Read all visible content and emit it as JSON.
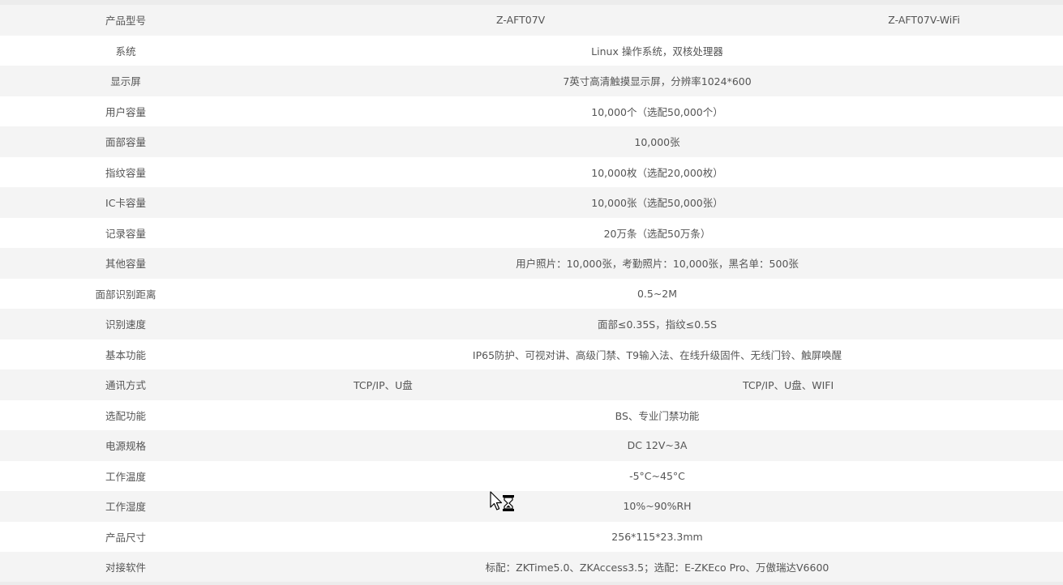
{
  "spec_table": {
    "rows": [
      {
        "label": "产品型号",
        "split": true,
        "left": "Z-AFT07V",
        "right": "Z-AFT07V-WiFi",
        "style": "model"
      },
      {
        "label": "系统",
        "value": "Linux 操作系统，双核处理器"
      },
      {
        "label": "显示屏",
        "value": "7英寸高清触摸显示屏，分辨率1024*600"
      },
      {
        "label": "用户容量",
        "value": "10,000个（选配50,000个）"
      },
      {
        "label": "面部容量",
        "value": "10,000张"
      },
      {
        "label": "指纹容量",
        "value": "10,000枚（选配20,000枚）"
      },
      {
        "label": "IC卡容量",
        "value": "10,000张（选配50,000张）"
      },
      {
        "label": "记录容量",
        "value": "20万条（选配50万条）"
      },
      {
        "label": "其他容量",
        "value": "用户照片：10,000张，考勤照片：10,000张，黑名单：500张"
      },
      {
        "label": "面部识别距离",
        "value": "0.5~2M"
      },
      {
        "label": "识别速度",
        "value": "面部≤0.35S，指纹≤0.5S"
      },
      {
        "label": "基本功能",
        "value": "IP65防护、可视对讲、高级门禁、T9输入法、在线升级固件、无线门铃、触屏唤醒"
      },
      {
        "label": "通讯方式",
        "split": true,
        "left": "TCP/IP、U盘",
        "right": "TCP/IP、U盘、WIFI",
        "style": "comm"
      },
      {
        "label": "选配功能",
        "value": "BS、专业门禁功能"
      },
      {
        "label": "电源规格",
        "value": "DC 12V~3A"
      },
      {
        "label": "工作温度",
        "value": "-5°C~45°C"
      },
      {
        "label": "工作湿度",
        "value": "10%~90%RH"
      },
      {
        "label": "产品尺寸",
        "value": "256*115*23.3mm"
      },
      {
        "label": "对接软件",
        "value": "标配：ZKTime5.0、ZKAccess3.5；选配：E-ZKEco Pro、万傲瑞达V6600"
      }
    ]
  },
  "cursor": {
    "icon": "busy-arrow-cursor-icon"
  },
  "colors": {
    "odd_row_bg": "#f4f4f4",
    "even_row_bg": "#ffffff",
    "text": "#555555"
  }
}
